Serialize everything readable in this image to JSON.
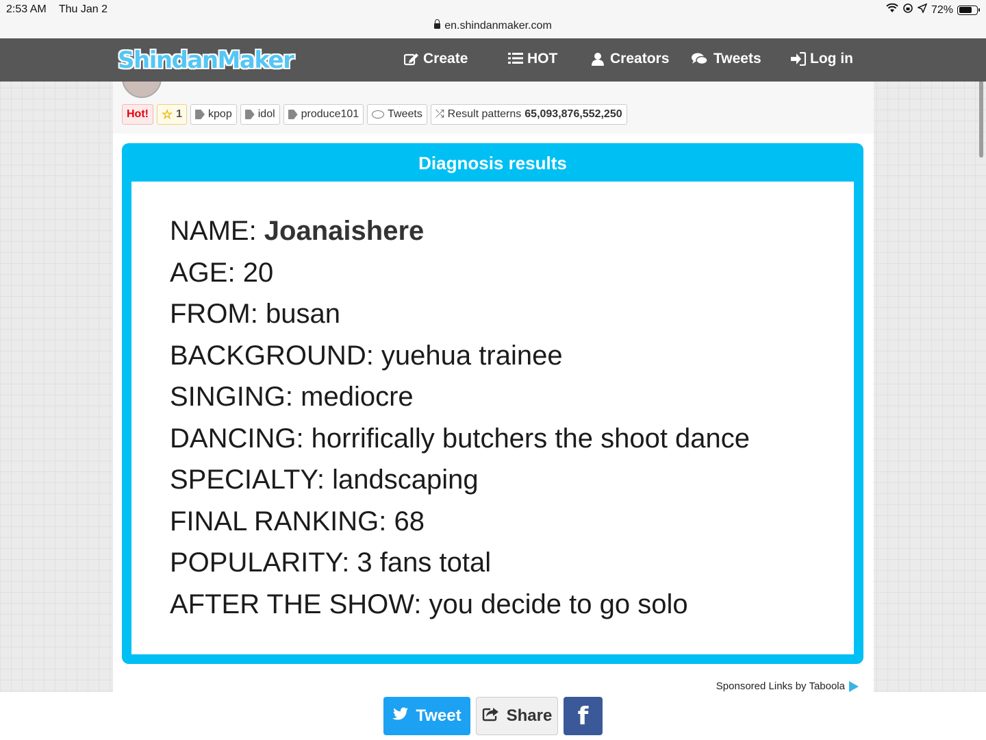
{
  "status_bar": {
    "time": "2:53 AM",
    "date": "Thu Jan 2",
    "battery": "72%",
    "battery_level": 0.72
  },
  "browser": {
    "url": "en.shindanmaker.com"
  },
  "navbar": {
    "logo": "ShindanMaker",
    "items": [
      {
        "label": "Create",
        "icon": "edit-icon"
      },
      {
        "label": "HOT",
        "icon": "list-icon"
      },
      {
        "label": "Creators",
        "icon": "user-icon"
      },
      {
        "label": "Tweets",
        "icon": "comments-icon"
      },
      {
        "label": "Log in",
        "icon": "sign-in-icon"
      }
    ]
  },
  "tags": {
    "hot": "Hot!",
    "favorites": "1",
    "tag_list": [
      "kpop",
      "idol",
      "produce101"
    ],
    "tweets": "Tweets",
    "patterns_label": "Result patterns",
    "patterns_value": "65,093,876,552,250"
  },
  "result": {
    "title": "Diagnosis results",
    "name_label": "NAME: ",
    "name_value": "Joanaishere",
    "lines": [
      "AGE: 20",
      "FROM: busan",
      "BACKGROUND: yuehua trainee",
      "SINGING: mediocre",
      "DANCING: horrifically butchers the shoot dance",
      "SPECIALTY: landscaping",
      "FINAL RANKING: 68",
      "POPULARITY: 3 fans total",
      "AFTER THE SHOW: you decide to go solo"
    ]
  },
  "sponsored": "Sponsored Links by Taboola",
  "share": {
    "tweet": "Tweet",
    "share": "Share",
    "facebook": "f"
  },
  "colors": {
    "accent": "#00bff3",
    "nav": "#575757",
    "tweet": "#1da1f2",
    "facebook": "#3b5998"
  }
}
